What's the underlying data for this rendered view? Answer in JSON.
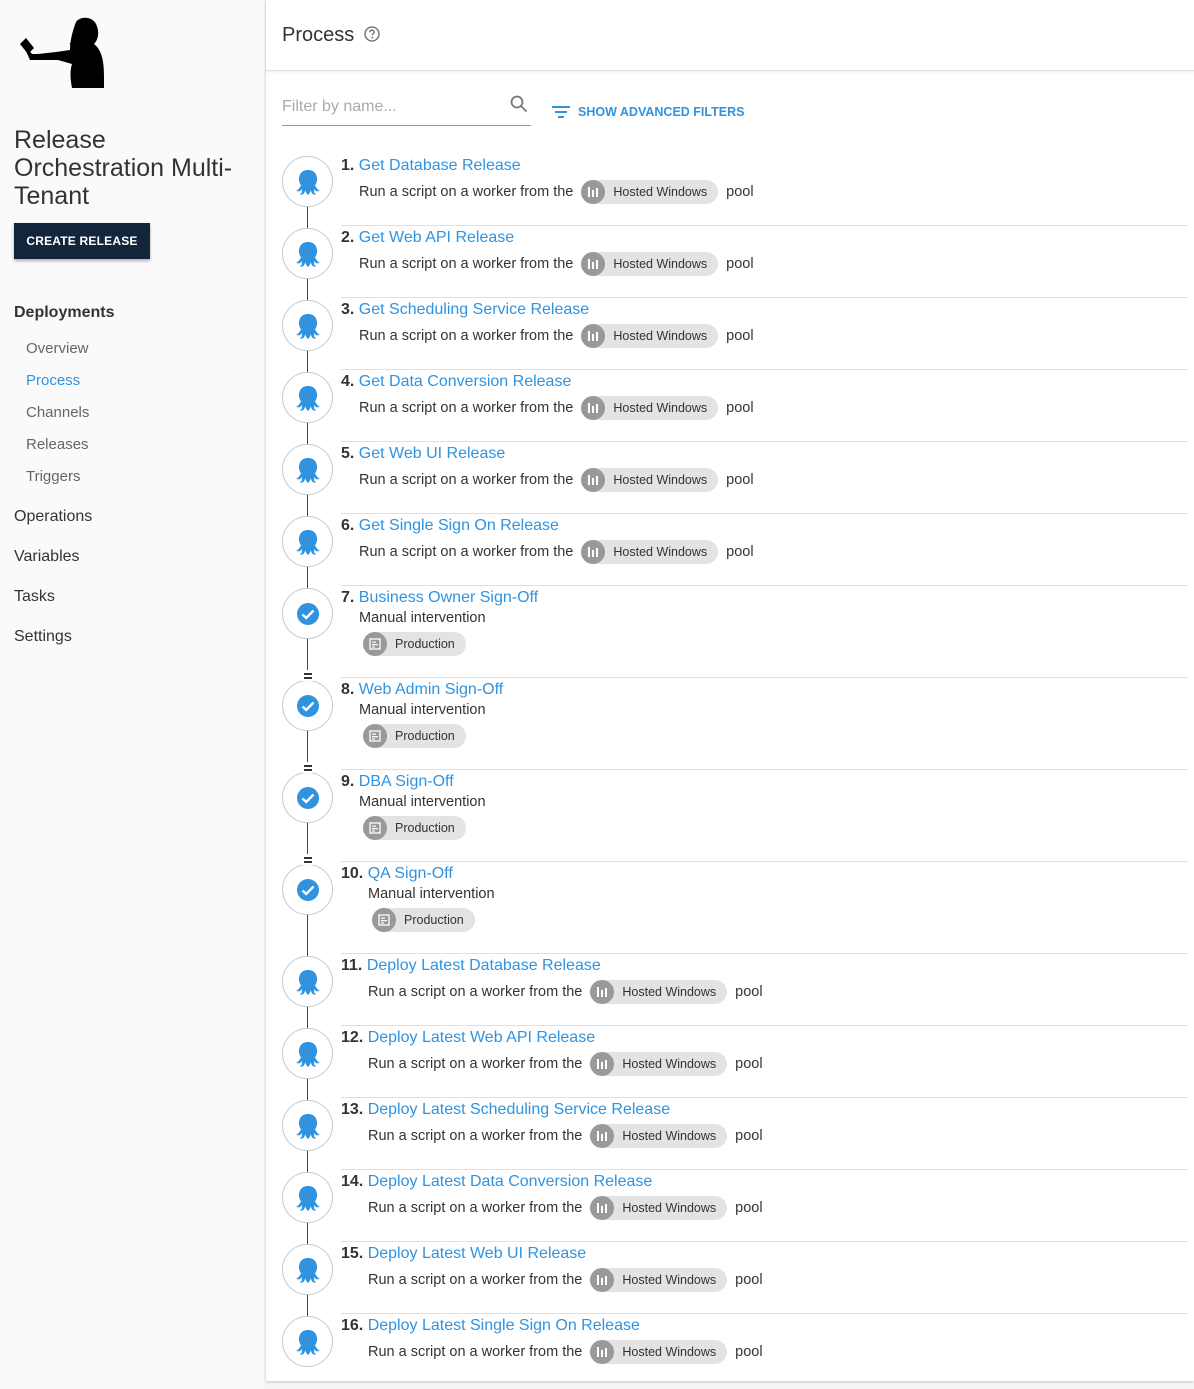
{
  "sidebar": {
    "project_name": "Release Orchestration Multi-Tenant",
    "create_release": "CREATE RELEASE",
    "deployments": "Deployments",
    "deployment_items": [
      "Overview",
      "Process",
      "Channels",
      "Releases",
      "Triggers"
    ],
    "active_item": "Process",
    "sections": [
      "Operations",
      "Variables",
      "Tasks",
      "Settings"
    ]
  },
  "header": {
    "title": "Process"
  },
  "filter": {
    "placeholder": "Filter by name...",
    "advanced_label": "SHOW ADVANCED FILTERS"
  },
  "steps": [
    {
      "num": "1.",
      "name": "Get Database Release",
      "type": "script",
      "desc_pre": "Run a script on a worker from the",
      "chip": "Hosted Windows",
      "desc_post": "pool"
    },
    {
      "num": "2.",
      "name": "Get Web API Release",
      "type": "script",
      "desc_pre": "Run a script on a worker from the",
      "chip": "Hosted Windows",
      "desc_post": "pool"
    },
    {
      "num": "3.",
      "name": "Get Scheduling Service Release",
      "type": "script",
      "desc_pre": "Run a script on a worker from the",
      "chip": "Hosted Windows",
      "desc_post": "pool"
    },
    {
      "num": "4.",
      "name": "Get Data Conversion Release",
      "type": "script",
      "desc_pre": "Run a script on a worker from the",
      "chip": "Hosted Windows",
      "desc_post": "pool"
    },
    {
      "num": "5.",
      "name": "Get Web UI Release",
      "type": "script",
      "desc_pre": "Run a script on a worker from the",
      "chip": "Hosted Windows",
      "desc_post": "pool"
    },
    {
      "num": "6.",
      "name": "Get Single Sign On Release",
      "type": "script",
      "desc_pre": "Run a script on a worker from the",
      "chip": "Hosted Windows",
      "desc_post": "pool"
    },
    {
      "num": "7.",
      "name": "Business Owner Sign-Off",
      "type": "manual",
      "desc": "Manual intervention",
      "chip": "Production"
    },
    {
      "num": "8.",
      "name": "Web Admin Sign-Off",
      "type": "manual",
      "desc": "Manual intervention",
      "chip": "Production"
    },
    {
      "num": "9.",
      "name": "DBA Sign-Off",
      "type": "manual",
      "desc": "Manual intervention",
      "chip": "Production"
    },
    {
      "num": "10.",
      "name": "QA Sign-Off",
      "type": "manual",
      "desc": "Manual intervention",
      "chip": "Production"
    },
    {
      "num": "11.",
      "name": "Deploy Latest Database Release",
      "type": "script",
      "desc_pre": "Run a script on a worker from the",
      "chip": "Hosted Windows",
      "desc_post": "pool"
    },
    {
      "num": "12.",
      "name": "Deploy Latest Web API Release",
      "type": "script",
      "desc_pre": "Run a script on a worker from the",
      "chip": "Hosted Windows",
      "desc_post": "pool"
    },
    {
      "num": "13.",
      "name": "Deploy Latest Scheduling Service Release",
      "type": "script",
      "desc_pre": "Run a script on a worker from the",
      "chip": "Hosted Windows",
      "desc_post": "pool"
    },
    {
      "num": "14.",
      "name": "Deploy Latest Data Conversion Release",
      "type": "script",
      "desc_pre": "Run a script on a worker from the",
      "chip": "Hosted Windows",
      "desc_post": "pool"
    },
    {
      "num": "15.",
      "name": "Deploy Latest Web UI Release",
      "type": "script",
      "desc_pre": "Run a script on a worker from the",
      "chip": "Hosted Windows",
      "desc_post": "pool"
    },
    {
      "num": "16.",
      "name": "Deploy Latest Single Sign On Release",
      "type": "script",
      "desc_pre": "Run a script on a worker from the",
      "chip": "Hosted Windows",
      "desc_post": "pool"
    }
  ],
  "colors": {
    "accent": "#2f93e0",
    "dark_button": "#12253a"
  }
}
